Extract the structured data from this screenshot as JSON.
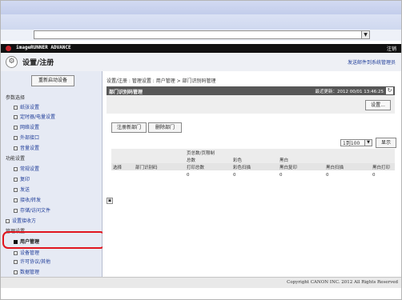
{
  "browser": {
    "address_dropdown_glyph": "▼"
  },
  "brand": {
    "name": "imageRUNNER ADVANCE",
    "logout": "注销"
  },
  "header": {
    "title": "设置/注册",
    "admin_link": "发送邮件到系统管理员"
  },
  "sidebar": {
    "restart_button": "重新启动设备",
    "sections": [
      {
        "label": "参数选择",
        "items": [
          "纸张设置",
          "定时器/电量设置",
          "网络设置",
          "外部接口",
          "音量设置"
        ]
      },
      {
        "label": "功能设置",
        "items": [
          "常规设置",
          "复印",
          "发送",
          "接收/转发",
          "存储/访问文件"
        ]
      }
    ],
    "dept_id": "设置接收方",
    "management_heading": "管理设置",
    "management_items": [
      "用户管理",
      "设备管理",
      "许可协议/其他",
      "数据管理"
    ],
    "active_item": "用户管理"
  },
  "breadcrumb": "设置/注册 : 管理设置 : 用户管理 > 部门识别码管理",
  "page": {
    "title": "部门识别码管理",
    "last_update": "最近更新：2012 00/01 13:46:25",
    "settings_button": "设置..."
  },
  "actions": {
    "register": "注册新部门",
    "delete": "删除部门"
  },
  "pagination": {
    "selected": "1到100",
    "show_button": "显示"
  },
  "table": {
    "group_header": "页总数/页限制",
    "sub_headers": {
      "total": "总数",
      "color": "彩色",
      "bw": "黑白"
    },
    "columns": [
      "选择",
      "部门识别码",
      "打印总数",
      "彩色扫描",
      "黑白复印",
      "黑白扫描",
      "黑白打印"
    ],
    "rows": [
      [
        "",
        "",
        "0",
        "0",
        "0",
        "0",
        "0"
      ]
    ]
  },
  "footer": {
    "copyright": "Copyright CANON INC. 2012 All Rights Reserved"
  },
  "colors": {
    "highlight": "#e0151e",
    "link": "#1f3d99",
    "header_bar": "#575757"
  }
}
